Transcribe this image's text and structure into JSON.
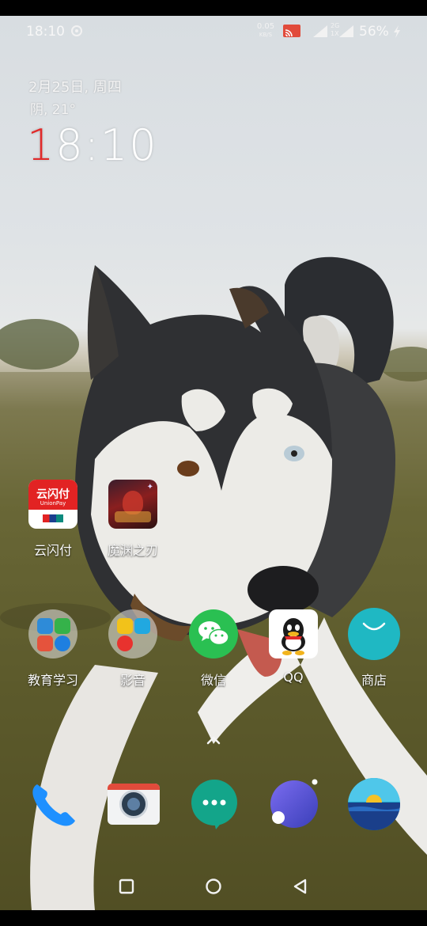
{
  "status_bar": {
    "time": "18:10",
    "speed_value": "0.05",
    "speed_unit": "KB/S",
    "network_line1": "2G",
    "network_line2": "1X",
    "battery": "56%"
  },
  "clock_widget": {
    "date": "2月25日, 周四",
    "weather": "阴, 21°",
    "time_accent": "1",
    "time_rest": "8:10"
  },
  "apps_row1": [
    {
      "label": "云闪付",
      "icon": "unionpay-icon"
    },
    {
      "label": "魔渊之刃",
      "icon": "game-icon"
    }
  ],
  "apps_row2": [
    {
      "label": "教育学习",
      "icon": "folder-icon"
    },
    {
      "label": "影音",
      "icon": "folder-icon"
    },
    {
      "label": "微信",
      "icon": "wechat-icon"
    },
    {
      "label": "QQ",
      "icon": "qq-icon"
    },
    {
      "label": "商店",
      "icon": "store-icon"
    }
  ],
  "unionpay_icon_text": {
    "main": "云闪付",
    "sub": "UnionPay"
  },
  "dock": [
    {
      "icon": "phone-icon"
    },
    {
      "icon": "camera-icon"
    },
    {
      "icon": "messages-icon"
    },
    {
      "icon": "assistant-icon"
    },
    {
      "icon": "weather-icon"
    }
  ],
  "colors": {
    "clock_accent": "#e12a2a",
    "wechat": "#2ac052",
    "store": "#1fb8c3",
    "messages": "#13a58a",
    "assistant": "#5a4fcf"
  }
}
